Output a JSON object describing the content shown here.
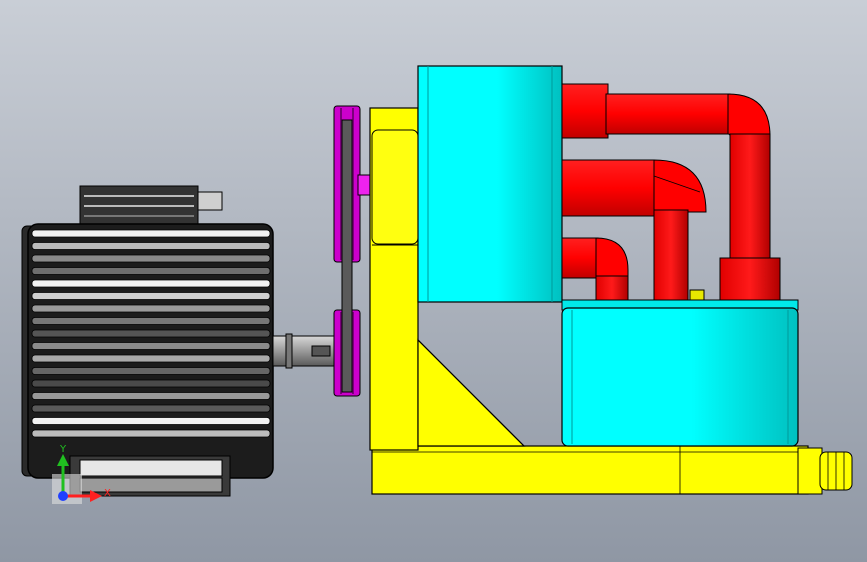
{
  "viewport": {
    "background_top": "#c9ced6",
    "background_bottom": "#8f97a4"
  },
  "colors": {
    "motor_dark": "#1e1e1e",
    "motor_mid": "#555555",
    "motor_light": "#f0f0f0",
    "shaft": "#9a9a9a",
    "pulley": "#cc00cc",
    "bracket": "#ffff00",
    "bracket_shade": "#d8d800",
    "pump": "#00ffff",
    "pump_shade": "#00c8c8",
    "pipe": "#ff0000",
    "pipe_shade": "#c80000",
    "outline": "#000000"
  },
  "triad": {
    "x_label": "X",
    "y_label": "Y",
    "x_color": "#ff2020",
    "y_color": "#20c020",
    "z_color": "#2040ff"
  }
}
